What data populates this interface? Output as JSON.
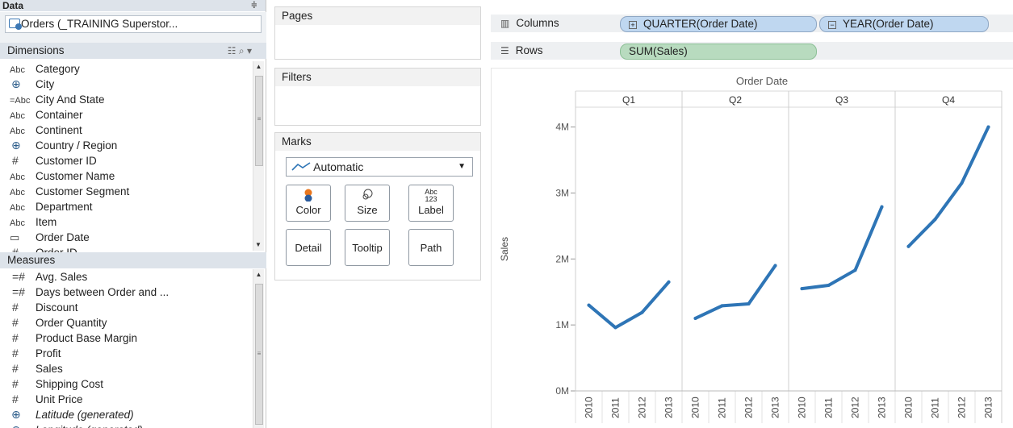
{
  "data_pane": {
    "title": "Data",
    "datasource": "Orders (_TRAINING Superstor...",
    "dimensions_label": "Dimensions",
    "measures_label": "Measures",
    "dimensions": [
      {
        "type": "Abc",
        "name": "Category"
      },
      {
        "type": "globe",
        "name": "City"
      },
      {
        "type": "=Abc",
        "name": "City And State"
      },
      {
        "type": "Abc",
        "name": "Container"
      },
      {
        "type": "Abc",
        "name": "Continent"
      },
      {
        "type": "globe",
        "name": "Country / Region"
      },
      {
        "type": "#",
        "name": "Customer ID"
      },
      {
        "type": "Abc",
        "name": "Customer Name"
      },
      {
        "type": "Abc",
        "name": "Customer Segment"
      },
      {
        "type": "Abc",
        "name": "Department"
      },
      {
        "type": "Abc",
        "name": "Item"
      },
      {
        "type": "calendar",
        "name": "Order Date"
      },
      {
        "type": "#",
        "name": "Order ID"
      }
    ],
    "measures": [
      {
        "type": "=#",
        "name": "Avg. Sales"
      },
      {
        "type": "=#",
        "name": "Days between Order and ..."
      },
      {
        "type": "#",
        "name": "Discount"
      },
      {
        "type": "#",
        "name": "Order Quantity"
      },
      {
        "type": "#",
        "name": "Product Base Margin"
      },
      {
        "type": "#",
        "name": "Profit"
      },
      {
        "type": "#",
        "name": "Sales"
      },
      {
        "type": "#",
        "name": "Shipping Cost"
      },
      {
        "type": "#",
        "name": "Unit Price"
      },
      {
        "type": "globe",
        "name": "Latitude (generated)",
        "italic": true
      },
      {
        "type": "globe",
        "name": "Longitude (generated)",
        "italic": true
      }
    ]
  },
  "cards": {
    "pages": "Pages",
    "filters": "Filters",
    "marks": "Marks",
    "mark_type": "Automatic",
    "buttons": {
      "color": "Color",
      "size": "Size",
      "label": "Label",
      "label_icon_top": "Abc",
      "label_icon_bottom": "123",
      "detail": "Detail",
      "tooltip": "Tooltip",
      "path": "Path"
    }
  },
  "shelves": {
    "columns_label": "Columns",
    "rows_label": "Rows",
    "column_pills": [
      "QUARTER(Order Date)",
      "YEAR(Order Date)"
    ],
    "row_pills": [
      "SUM(Sales)"
    ]
  },
  "chart_data": {
    "type": "line",
    "column_header_title": "Order Date",
    "panels": [
      "Q1",
      "Q2",
      "Q3",
      "Q4"
    ],
    "x": [
      "2010",
      "2011",
      "2012",
      "2013"
    ],
    "ylabel": "Sales",
    "ylim": [
      0,
      4300000
    ],
    "yticks": [
      0,
      1000000,
      2000000,
      3000000,
      4000000
    ],
    "ytick_labels": [
      "0M",
      "1M",
      "2M",
      "3M",
      "4M"
    ],
    "series": [
      {
        "panel": "Q1",
        "values": [
          1300000,
          960000,
          1190000,
          1650000
        ]
      },
      {
        "panel": "Q2",
        "values": [
          1100000,
          1290000,
          1320000,
          1900000
        ]
      },
      {
        "panel": "Q3",
        "values": [
          1550000,
          1600000,
          1830000,
          2790000
        ]
      },
      {
        "panel": "Q4",
        "values": [
          2190000,
          2600000,
          3150000,
          4000000
        ]
      }
    ],
    "line_color": "#2e75b6",
    "grid": false
  }
}
